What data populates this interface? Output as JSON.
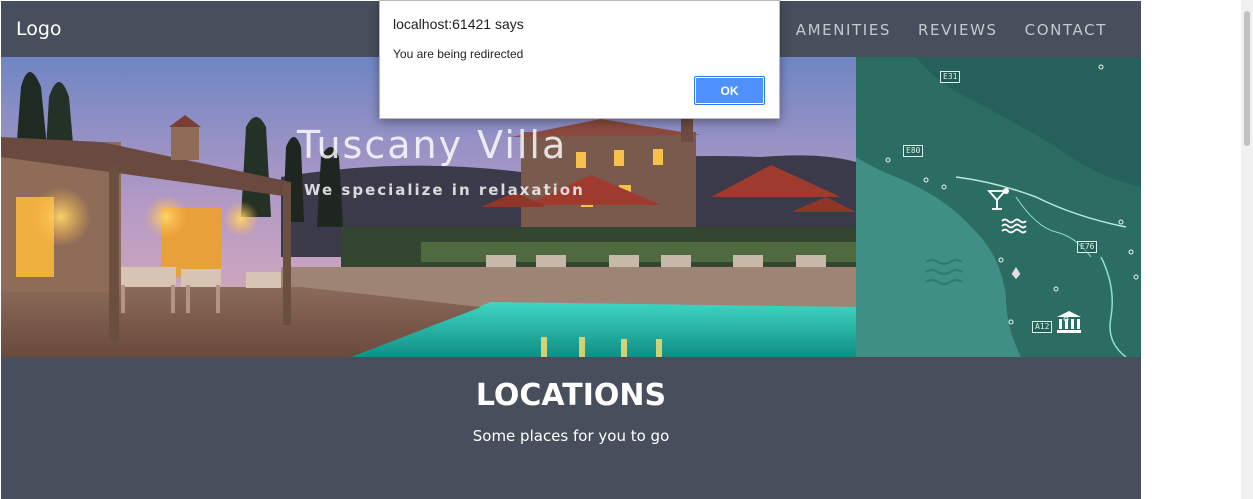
{
  "site": {
    "logo": "Logo",
    "nav": {
      "amenities": "AMENITIES",
      "reviews": "REVIEWS",
      "contact": "CONTACT"
    },
    "hero": {
      "title": "Tuscany Villa",
      "subtitle": "We specialize in relaxation"
    },
    "map": {
      "road_labels": [
        "E31",
        "E80",
        "E76",
        "A12"
      ],
      "icons": [
        "cocktail-icon",
        "waves-icon",
        "museum-icon",
        "pin-icon"
      ]
    },
    "locations": {
      "title": "LOCATIONS",
      "subtitle": "Some places for you to go"
    }
  },
  "alert": {
    "title": "localhost:61421 says",
    "message": "You are being redirected",
    "ok_label": "OK"
  },
  "colors": {
    "site_bg": "#474f5c",
    "map_sea": "#3f8f84",
    "map_land": "#2c6d63",
    "alert_button": "#4d90fe"
  }
}
